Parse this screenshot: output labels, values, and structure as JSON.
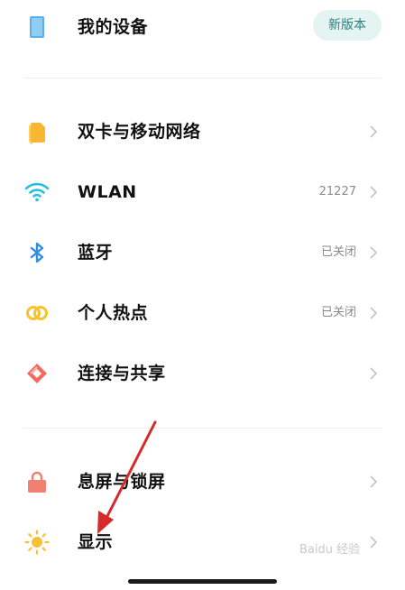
{
  "my_device": {
    "label": "我的设备",
    "badge": "新版本"
  },
  "items": [
    {
      "label": "双卡与移动网络",
      "value": ""
    },
    {
      "label": "WLAN",
      "value": "21227"
    },
    {
      "label": "蓝牙",
      "value": "已关闭"
    },
    {
      "label": "个人热点",
      "value": "已关闭"
    },
    {
      "label": "连接与共享",
      "value": ""
    },
    {
      "label": "息屏与锁屏",
      "value": ""
    },
    {
      "label": "显示",
      "value": ""
    }
  ],
  "watermark": "Baidu 经验",
  "colors": {
    "accent_teal": "#2b7f7a",
    "sim_yellow": "#f7b733",
    "wifi_cyan": "#27c0dc",
    "bluetooth_blue": "#2f8fe0",
    "hotspot_yellow": "#f4c42f",
    "connection_red": "#f26b5e",
    "lock_red": "#f08070",
    "display_yellow": "#f6c13a",
    "arrow_red": "#d62b2b"
  }
}
